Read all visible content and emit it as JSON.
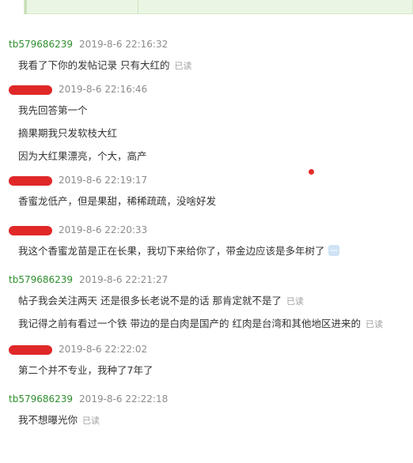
{
  "messages": [
    {
      "sender": "tb579686239",
      "redacted": false,
      "time": "2019-8-6 22:16:32",
      "lines": [
        {
          "text": "我看了下你的发帖记录 只有大红的",
          "status": "已读"
        }
      ]
    },
    {
      "sender": "",
      "redacted": true,
      "time": "2019-8-6 22:16:46",
      "lines": [
        {
          "text": "我先回答第一个",
          "status": ""
        },
        {
          "text": "摘果期我只发软枝大红",
          "status": ""
        },
        {
          "text": "因为大红果漂亮，个大，高产",
          "status": ""
        }
      ]
    },
    {
      "sender": "",
      "redacted": true,
      "time": "2019-8-6 22:19:17",
      "lines": [
        {
          "text": "香蜜龙低产，但是果甜，稀稀疏疏，没啥好发",
          "status": ""
        }
      ]
    },
    {
      "sender": "",
      "redacted": true,
      "time": "2019-8-6 22:20:33",
      "lines": [
        {
          "text": "我这个香蜜龙苗是正在长果，我切下来给你了，带金边应该是多年树了",
          "status": "",
          "icon": "more-icon"
        }
      ]
    },
    {
      "sender": "tb579686239",
      "redacted": false,
      "time": "2019-8-6 22:21:27",
      "lines": [
        {
          "text": "帖子我会关注两天 还是很多长老说不是的话 那肯定就不是了",
          "status": "已读"
        },
        {
          "text": "我记得之前有看过一个铁 带边的是白肉是国产的 红肉是台湾和其他地区进来的",
          "status": "已读"
        }
      ]
    },
    {
      "sender": "",
      "redacted": true,
      "time": "2019-8-6 22:22:02",
      "lines": [
        {
          "text": "第二个并不专业，我种了7年了",
          "status": ""
        }
      ]
    },
    {
      "sender": "tb579686239",
      "redacted": false,
      "time": "2019-8-6 22:22:18",
      "lines": [
        {
          "text": "我不想曝光你",
          "status": "已读"
        }
      ]
    }
  ]
}
